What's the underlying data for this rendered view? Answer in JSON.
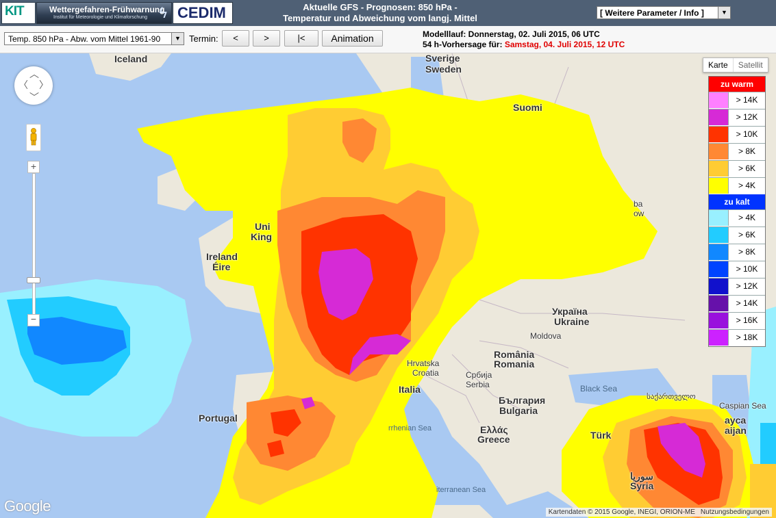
{
  "header": {
    "title_line1": "Aktuelle GFS - Prognosen: 850 hPa -",
    "title_line2": "Temperatur und Abweichung vom langj. Mittel",
    "param_select": "[ Weitere Parameter / Info ]",
    "logo_kit": "KIT",
    "logo_wgf": "Wettergefahren-Frühwarnung",
    "logo_wgf_sub": "Institut für Meteorologie und Klimaforschung",
    "logo_cedim": "CEDIM"
  },
  "controls": {
    "variable_select": "Temp. 850 hPa - Abw. vom Mittel 1961-90",
    "termin_label": "Termin:",
    "prev_label": "<",
    "next_label": ">",
    "first_label": "|<",
    "animation_label": "Animation",
    "model_run": "Modelllauf: Donnerstag, 02. Juli 2015, 06 UTC",
    "forecast_prefix": "54 h-Vorhersage für: ",
    "forecast_time": "Samstag, 04. Juli 2015, 12 UTC"
  },
  "map": {
    "type_map": "Karte",
    "type_sat": "Satellit",
    "zoom_level_fraction": 0.25,
    "labels": {
      "iceland": "Iceland",
      "sverige": "Sverige",
      "sweden": "Sweden",
      "suomi": "Suomi",
      "ireland": "Ireland",
      "eire": "Éire",
      "uk1": "Uni",
      "uk2": "King",
      "ukraina": "Україна",
      "ukraine": "Ukraine",
      "moldova": "Moldova",
      "romania1": "România",
      "romania2": "Romania",
      "hrvatska": "Hrvatska",
      "croatia": "Croatia",
      "srbija": "Србија",
      "serbia": "Serbia",
      "italia": "Italia",
      "bulgaria1": "България",
      "bulgaria2": "Bulgaria",
      "ellas": "Ελλάς",
      "greece": "Greece",
      "turk": "Türk",
      "portugal": "Portugal",
      "black_sea": "Black Sea",
      "caspian": "Caspian Sea",
      "caspian2": "ayca",
      "azer": "aijan",
      "tyrrhenian": "rrhenian Sea",
      "mediterranean": "iterranean Sea",
      "syria": "سوريا",
      "syria2": "Syria",
      "georgia": "საქართველო",
      "ba": "ba",
      "ow": "ow"
    }
  },
  "legend": {
    "warm_title": "zu warm",
    "cold_title": "zu kalt",
    "warm": [
      {
        "label": "> 14K",
        "color": "#ff80ff"
      },
      {
        "label": "> 12K",
        "color": "#d62ad6"
      },
      {
        "label": "> 10K",
        "color": "#ff3300"
      },
      {
        "label": "> 8K",
        "color": "#ff8833"
      },
      {
        "label": "> 6K",
        "color": "#ffcc33"
      },
      {
        "label": "> 4K",
        "color": "#ffff00"
      }
    ],
    "cold": [
      {
        "label": "> 4K",
        "color": "#99f0ff"
      },
      {
        "label": "> 6K",
        "color": "#22ccff"
      },
      {
        "label": "> 8K",
        "color": "#1188ff"
      },
      {
        "label": "> 10K",
        "color": "#0044ff"
      },
      {
        "label": "> 12K",
        "color": "#1111cc"
      },
      {
        "label": "> 14K",
        "color": "#6611aa"
      },
      {
        "label": "> 16K",
        "color": "#9911dd"
      },
      {
        "label": "> 18K",
        "color": "#cc22ff"
      }
    ],
    "warm_title_color": "#ff0000",
    "cold_title_color": "#0033ff"
  },
  "footer": {
    "google": "Google",
    "attribution": "Kartendaten © 2015 Google, INEGI, ORION-ME",
    "terms": "Nutzungsbedingungen"
  }
}
